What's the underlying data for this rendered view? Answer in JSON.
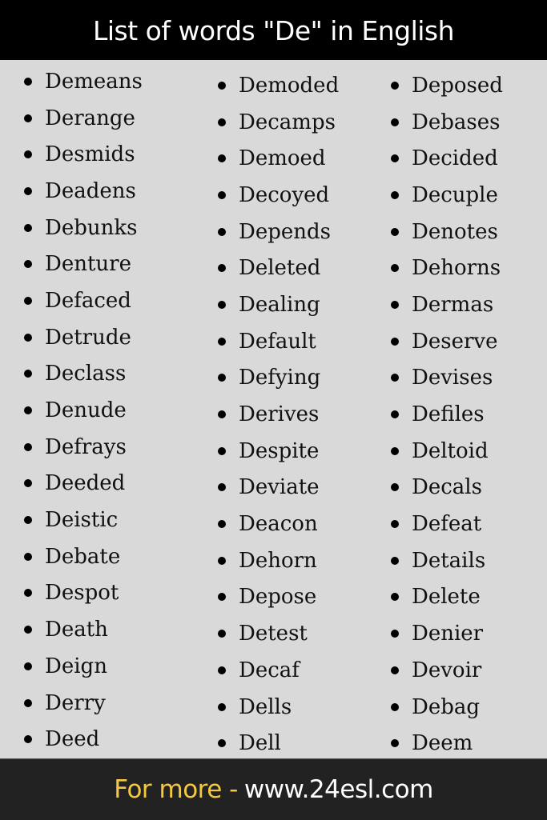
{
  "header": {
    "title": "List of words \"De\" in English"
  },
  "columns": [
    {
      "items": [
        "Demeans",
        "Derange",
        "Desmids",
        "Deadens",
        "Debunks",
        "Denture",
        "Defaced",
        "Detrude",
        "Declass",
        "Denude",
        "Defrays",
        "Deeded",
        "Deistic",
        "Debate",
        "Despot",
        "Death",
        "Deign",
        "Derry",
        "Deed"
      ]
    },
    {
      "items": [
        "Demoded",
        "Decamps",
        "Demoed",
        "Decoyed",
        "Depends",
        "Deleted",
        "Dealing",
        "Default",
        "Defying",
        "Derives",
        "Despite",
        "Deviate",
        "Deacon",
        "Dehorn",
        "Depose",
        "Detest",
        "Decaf",
        "Dells",
        "Dell"
      ]
    },
    {
      "items": [
        "Deposed",
        "Debases",
        "Decided",
        "Decuple",
        "Denotes",
        "Dehorns",
        "Dermas",
        "Deserve",
        "Devises",
        "Defiles",
        "Deltoid",
        "Decals",
        "Defeat",
        "Details",
        "Delete",
        "Denier",
        "Devoir",
        "Debag",
        "Deem"
      ]
    }
  ],
  "footer": {
    "prefix": "For more -",
    "url": "www.24esl.com"
  },
  "colors": {
    "header_bg": "#000000",
    "body_bg": "#d9d9d9",
    "footer_bg": "#222222",
    "footer_accent": "#f5c842",
    "text": "#111111"
  }
}
